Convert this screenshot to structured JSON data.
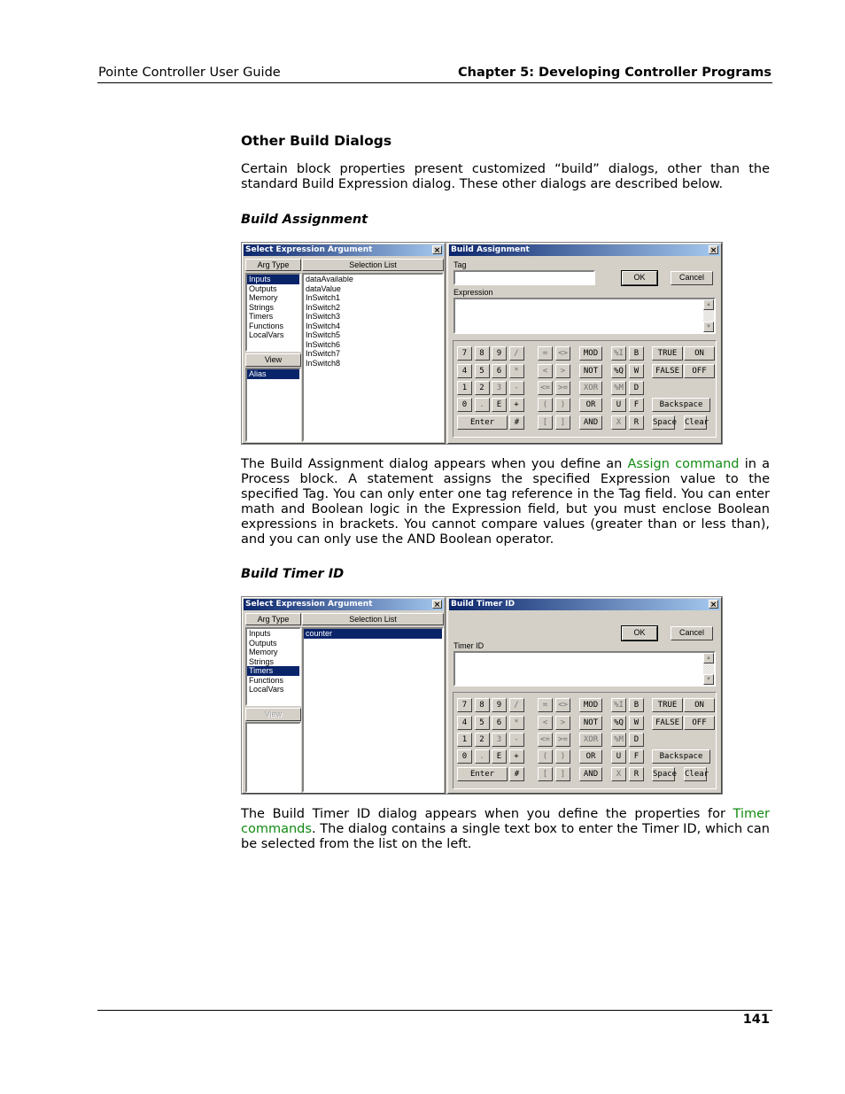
{
  "header": {
    "left": "Pointe Controller User Guide",
    "right": "Chapter 5: Developing Controller Programs"
  },
  "section": {
    "title": "Other Build Dialogs",
    "intro": "Certain block properties present customized “build” dialogs, other than the standard Build Expression dialog. These other dialogs are described below."
  },
  "build_assignment": {
    "heading": "Build Assignment",
    "para_pre": "The Build Assignment dialog appears when you define an ",
    "para_link": "Assign command",
    "para_post": " in a Process block. A statement assigns the specified Expression value to the specified Tag. You can only enter one tag reference in the Tag field. You can enter math and Boolean logic in the Expression field, but you must enclose Boolean expressions in brackets. You cannot compare values (greater than or less than), and you can only use the AND Boolean operator.",
    "select_dialog": {
      "title": "Select Expression Argument",
      "arg_type_header": "Arg Type",
      "selection_list_header": "Selection List",
      "arg_types": [
        "Inputs",
        "Outputs",
        "Memory",
        "Strings",
        "Timers",
        "Functions",
        "LocalVars"
      ],
      "selected_arg_type": "Inputs",
      "view_button": "View",
      "view_items": [
        "Alias"
      ],
      "selection_items": [
        "dataAvailable",
        "dataValue",
        "InSwitch1",
        "InSwitch2",
        "InSwitch3",
        "InSwitch4",
        "InSwitch5",
        "InSwitch6",
        "InSwitch7",
        "InSwitch8"
      ]
    },
    "build_dialog": {
      "title": "Build Assignment",
      "tag_label": "Tag",
      "tag_value": "",
      "expression_label": "Expression",
      "expression_value": "",
      "ok": "OK",
      "cancel": "Cancel"
    }
  },
  "build_timer": {
    "heading": "Build Timer ID",
    "para_pre": "The Build Timer ID dialog appears when you define the properties for ",
    "para_link": "Timer commands",
    "para_post": ". The dialog contains a single text box to enter the Timer ID, which can be selected from the list on the left.",
    "select_dialog": {
      "title": "Select Expression Argument",
      "arg_type_header": "Arg Type",
      "selection_list_header": "Selection List",
      "arg_types": [
        "Inputs",
        "Outputs",
        "Memory",
        "Strings",
        "Timers",
        "Functions",
        "LocalVars"
      ],
      "selected_arg_type": "Timers",
      "view_button": "View",
      "selection_items": [
        "counter"
      ],
      "selected_item": "counter"
    },
    "build_dialog": {
      "title": "Build Timer ID",
      "timer_label": "Timer ID",
      "timer_value": "",
      "ok": "OK",
      "cancel": "Cancel"
    }
  },
  "keypad": {
    "digits": [
      [
        "7",
        "8",
        "9",
        "/"
      ],
      [
        "4",
        "5",
        "6",
        "*"
      ],
      [
        "1",
        "2",
        "3",
        "-"
      ],
      [
        "0",
        ".",
        "E",
        "+"
      ]
    ],
    "enter": "Enter",
    "hash": "#",
    "compare": [
      [
        "=",
        "<>"
      ],
      [
        "<",
        ">"
      ],
      [
        "<=",
        ">="
      ],
      [
        "(",
        ")"
      ],
      [
        "[",
        "]"
      ]
    ],
    "logic": [
      "MOD",
      "NOT",
      "XOR",
      "OR",
      "AND"
    ],
    "types": [
      [
        "%I",
        "B"
      ],
      [
        "%Q",
        "W"
      ],
      [
        "%M",
        "D"
      ],
      [
        "U",
        "F"
      ],
      [
        "X",
        "R"
      ]
    ],
    "bool": [
      [
        "TRUE",
        "ON"
      ],
      [
        "FALSE",
        "OFF"
      ]
    ],
    "backspace": "Backspace",
    "space": "Space",
    "clear": "Clear"
  },
  "footer": {
    "page_number": "141"
  },
  "colors": {
    "link": "#128a12",
    "titlebar_start": "#0a246a",
    "titlebar_end": "#a6caf0",
    "dialog_bg": "#d4d0c8",
    "selection": "#0a246a"
  }
}
